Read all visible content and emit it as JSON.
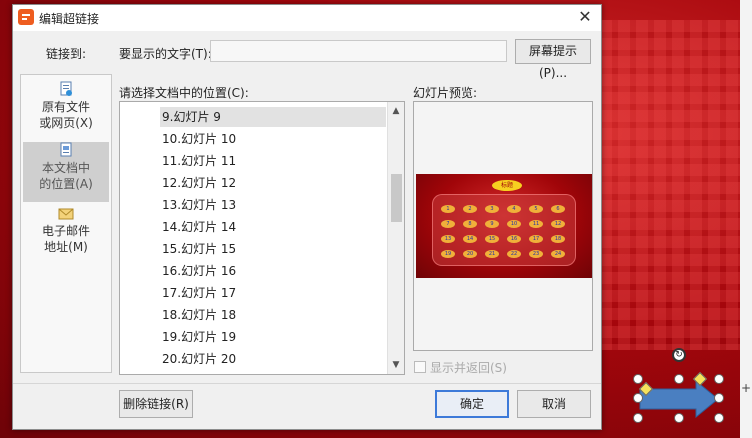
{
  "dialog": {
    "title": "编辑超链接",
    "close_glyph": "✕",
    "link_to_label": "链接到:",
    "display_text_label": "要显示的文字(T):",
    "display_text_value": "",
    "screen_tip_button": "屏幕提示(P)...",
    "location_label": "请选择文档中的位置(C):",
    "preview_label": "幻灯片预览:",
    "show_and_return_label": "显示并返回(S)",
    "remove_link_button": "删除链接(R)",
    "ok_button": "确定",
    "cancel_button": "取消"
  },
  "link_to": [
    {
      "line1": "原有文件",
      "line2": "或网页(X)",
      "icon": "file-icon",
      "selected": false
    },
    {
      "line1": "本文档中",
      "line2": "的位置(A)",
      "icon": "document-place-icon",
      "selected": true
    },
    {
      "line1": "电子邮件",
      "line2": "地址(M)",
      "icon": "email-icon",
      "selected": false
    }
  ],
  "slides": [
    "9.幻灯片 9",
    "10.幻灯片 10",
    "11.幻灯片 11",
    "12.幻灯片 12",
    "13.幻灯片 13",
    "14.幻灯片 14",
    "15.幻灯片 15",
    "16.幻灯片 16",
    "17.幻灯片 17",
    "18.幻灯片 18",
    "19.幻灯片 19",
    "20.幻灯片 20"
  ],
  "preview": {
    "title_badge": "标题",
    "numbers": [
      "1",
      "2",
      "3",
      "4",
      "5",
      "6",
      "7",
      "8",
      "9",
      "10",
      "11",
      "12",
      "13",
      "14",
      "15",
      "16",
      "17",
      "18",
      "19",
      "20",
      "21",
      "22",
      "23",
      "24"
    ]
  },
  "colors": {
    "slide_bg": "#b5141a",
    "accent_orange": "#ee5d20",
    "primary_border": "#3d7ad9",
    "arrow_fill": "#4a7fc1"
  },
  "canvas": {
    "right_plus": "+",
    "rotate_glyph": "↻"
  }
}
